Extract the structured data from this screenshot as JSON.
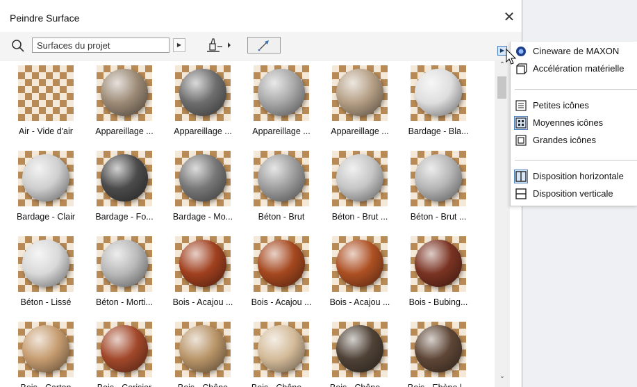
{
  "window": {
    "title": "Peindre Surface",
    "close_glyph": "✕"
  },
  "toolbar": {
    "search_placeholder": "Surfaces du projet",
    "search_arrow_glyph": "▶",
    "icons": [
      "search-icon",
      "paint-bucket-icon",
      "eyedropper-icon"
    ]
  },
  "scrollbar": {
    "up_glyph": "⌃",
    "down_glyph": "⌄"
  },
  "flyout": {
    "toggle_glyph": "▶"
  },
  "materials": [
    {
      "label": "Air - Vide d'air",
      "sphere": null
    },
    {
      "label": "Appareillage ...",
      "sphere": "#9c8a76"
    },
    {
      "label": "Appareillage ...",
      "sphere": "#6e6e6e"
    },
    {
      "label": "Appareillage ...",
      "sphere": "#a8a8a8"
    },
    {
      "label": "Appareillage ...",
      "sphere": "#b59f85"
    },
    {
      "label": "Bardage - Bla...",
      "sphere": "#dedede"
    },
    {
      "label": "Bardage - Clair",
      "sphere": "#cfcfcf"
    },
    {
      "label": "Bardage - Fo...",
      "sphere": "#4b4b4b"
    },
    {
      "label": "Bardage - Mo...",
      "sphere": "#787878"
    },
    {
      "label": "Béton - Brut",
      "sphere": "#9e9e9e"
    },
    {
      "label": "Béton - Brut ...",
      "sphere": "#c6c6c6"
    },
    {
      "label": "Béton - Brut ...",
      "sphere": "#b6b6b6"
    },
    {
      "label": "Béton - Lissé",
      "sphere": "#d9d9d9"
    },
    {
      "label": "Béton - Morti...",
      "sphere": "#b9b9b9"
    },
    {
      "label": "Bois - Acajou ...",
      "sphere": "#a0401f"
    },
    {
      "label": "Bois - Acajou ...",
      "sphere": "#a5481f"
    },
    {
      "label": "Bois - Acajou ...",
      "sphere": "#ad5023"
    },
    {
      "label": "Bois - Bubing...",
      "sphere": "#7a3322"
    },
    {
      "label": "Bois - Carton",
      "sphere": "#c69c70"
    },
    {
      "label": "Bois - Cerisier",
      "sphere": "#a2482a"
    },
    {
      "label": "Bois - Chêne",
      "sphere": "#b99569"
    },
    {
      "label": "Bois - Chêne ...",
      "sphere": "#d4bb99"
    },
    {
      "label": "Bois - Chêne ...",
      "sphere": "#4f4236"
    },
    {
      "label": "Bois - Ebène l...",
      "sphere": "#5e4636"
    }
  ],
  "menu": {
    "items": [
      {
        "label": "Cineware de MAXON",
        "icon": "cineware-icon"
      },
      {
        "label": "Accélération matérielle",
        "icon": "hardware-acceleration-icon"
      },
      {
        "label": "Petites icônes",
        "icon": "small-icons-icon"
      },
      {
        "label": "Moyennes icônes",
        "icon": "medium-icons-icon",
        "selected": true
      },
      {
        "label": "Grandes icônes",
        "icon": "large-icons-icon"
      },
      {
        "label": "Disposition horizontale",
        "icon": "horizontal-layout-icon",
        "selected": true
      },
      {
        "label": "Disposition verticale",
        "icon": "vertical-layout-icon"
      }
    ]
  },
  "colors": {
    "accent": "#4a7fbf",
    "selection": "#d6e6f7"
  }
}
